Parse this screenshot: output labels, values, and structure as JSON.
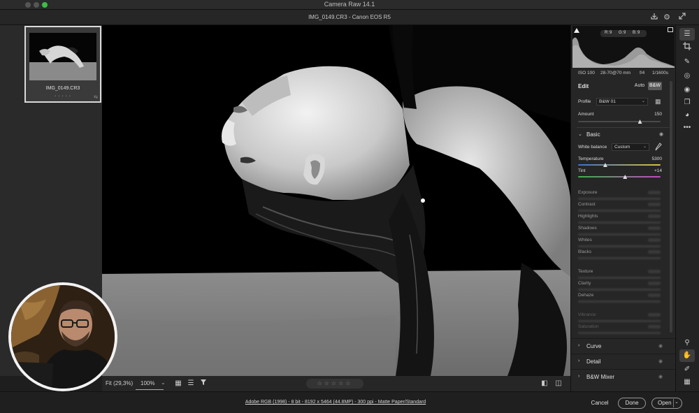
{
  "app": {
    "title": "Camera Raw 14.1",
    "file_title": "IMG_0149.CR3  -  Canon EOS R5"
  },
  "filmstrip": {
    "items": [
      {
        "name": "IMG_0149.CR3",
        "stars": "• • • • •"
      }
    ]
  },
  "histogram": {
    "r_label": "R:",
    "r_value": "9",
    "g_label": "G:",
    "g_value": "9",
    "b_label": "B:",
    "b_value": "9"
  },
  "exif": {
    "iso": "ISO 100",
    "lens": "28-70@70 mm",
    "aperture": "f/4",
    "shutter": "1/1600s"
  },
  "edit": {
    "title": "Edit",
    "auto_label": "Auto",
    "bw_label": "B&W",
    "profile_label": "Profile",
    "profile_value": "B&W 01",
    "amount_label": "Amount",
    "amount_value": "150",
    "amount_level": 0.75
  },
  "basic": {
    "title": "Basic",
    "white_balance_label": "White balance",
    "white_balance_value": "Custom",
    "temperature_label": "Temperature",
    "temperature_value": "5300",
    "temperature_level": 0.33,
    "tint_label": "Tint",
    "tint_value": "+14",
    "tint_level": 0.57,
    "sliders": [
      {
        "label": "Exposure"
      },
      {
        "label": "Contrast"
      },
      {
        "label": "Highlights"
      },
      {
        "label": "Shadows"
      },
      {
        "label": "Whites"
      },
      {
        "label": "Blacks"
      },
      {
        "label": "Texture"
      },
      {
        "label": "Clarity"
      },
      {
        "label": "Dehaze"
      },
      {
        "label": "Vibrance"
      },
      {
        "label": "Saturation"
      }
    ]
  },
  "sections": [
    {
      "name": "Curve"
    },
    {
      "name": "Detail"
    },
    {
      "name": "B&W Mixer"
    }
  ],
  "bottombar": {
    "zoom_fit": "Fit (29,3%)",
    "zoom_100": "100%",
    "stars": "☆☆☆☆☆"
  },
  "footer": {
    "workflow": "Adobe RGB (1998) - 8 bit - 8192 x 5464 (44.8MP) - 300 ppi - Matte Paper/Standard",
    "cancel": "Cancel",
    "done": "Done",
    "open": "Open"
  },
  "icons": {
    "accent": "#4aa3ff"
  }
}
